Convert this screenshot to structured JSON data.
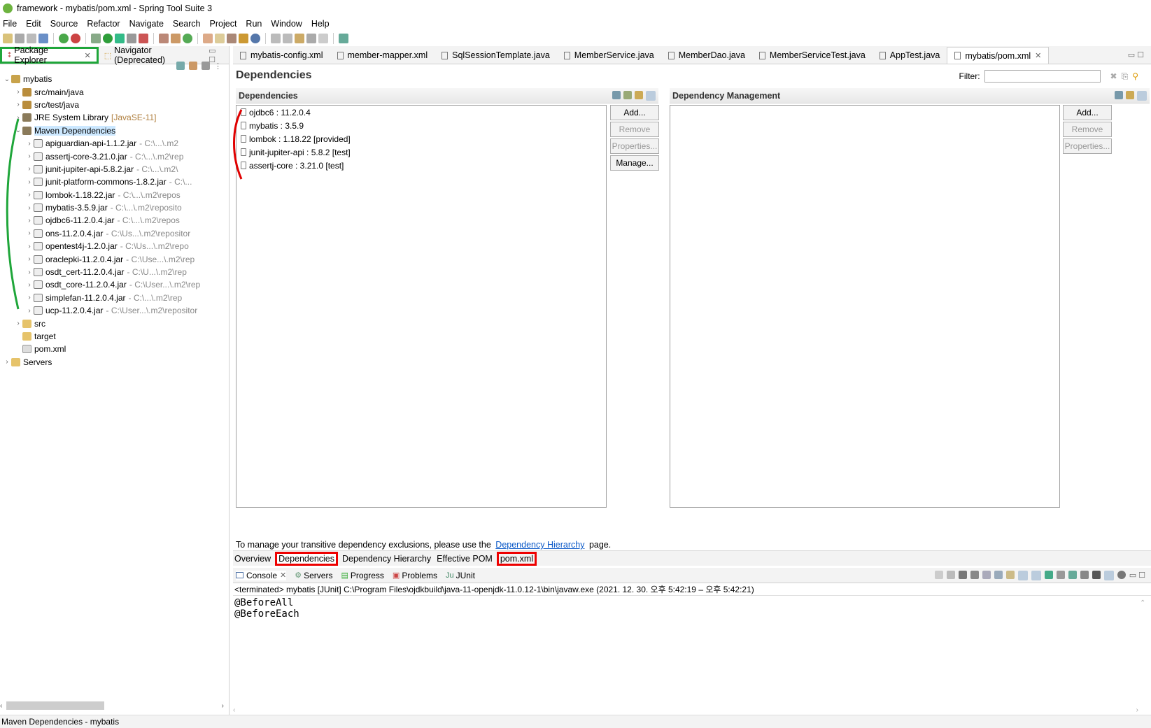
{
  "window": {
    "title": "framework - mybatis/pom.xml - Spring Tool Suite 3"
  },
  "menu": [
    "File",
    "Edit",
    "Source",
    "Refactor",
    "Navigate",
    "Search",
    "Project",
    "Run",
    "Window",
    "Help"
  ],
  "left_panel": {
    "tabs": [
      {
        "label": "Package Explorer",
        "active": true
      },
      {
        "label": "Navigator (Deprecated)",
        "active": false
      }
    ],
    "tree": [
      {
        "label": "mybatis",
        "indent": 0,
        "icon": "project-icon",
        "expanded": true
      },
      {
        "label": "src/main/java",
        "indent": 1,
        "icon": "package-folder-icon"
      },
      {
        "label": "src/test/java",
        "indent": 1,
        "icon": "package-folder-icon"
      },
      {
        "label": "JRE System Library",
        "suffix": "[JavaSE-11]",
        "indent": 1,
        "icon": "library-icon"
      },
      {
        "label": "Maven Dependencies",
        "indent": 1,
        "icon": "library-icon",
        "expanded": true,
        "selected": true
      },
      {
        "label": "apiguardian-api-1.1.2.jar",
        "path": "- C:\\...\\.m2",
        "indent": 2,
        "icon": "jar-icon"
      },
      {
        "label": "assertj-core-3.21.0.jar",
        "path": "- C:\\...\\.m2\\rep",
        "indent": 2,
        "icon": "jar-icon"
      },
      {
        "label": "junit-jupiter-api-5.8.2.jar",
        "path": "- C:\\...\\.m2\\",
        "indent": 2,
        "icon": "jar-icon"
      },
      {
        "label": "junit-platform-commons-1.8.2.jar",
        "path": "- C:\\...",
        "indent": 2,
        "icon": "jar-icon"
      },
      {
        "label": "lombok-1.18.22.jar",
        "path": "- C:\\...\\.m2\\repos",
        "indent": 2,
        "icon": "jar-icon"
      },
      {
        "label": "mybatis-3.5.9.jar",
        "path": "- C:\\...\\.m2\\reposito",
        "indent": 2,
        "icon": "jar-icon"
      },
      {
        "label": "ojdbc6-11.2.0.4.jar",
        "path": "- C:\\...\\.m2\\repos",
        "indent": 2,
        "icon": "jar-icon"
      },
      {
        "label": "ons-11.2.0.4.jar",
        "path": "- C:\\Us...\\.m2\\repositor",
        "indent": 2,
        "icon": "jar-icon"
      },
      {
        "label": "opentest4j-1.2.0.jar",
        "path": "- C:\\Us...\\.m2\\repo",
        "indent": 2,
        "icon": "jar-icon"
      },
      {
        "label": "oraclepki-11.2.0.4.jar",
        "path": "- C:\\Use...\\.m2\\rep",
        "indent": 2,
        "icon": "jar-icon"
      },
      {
        "label": "osdt_cert-11.2.0.4.jar",
        "path": "- C:\\U...\\.m2\\rep",
        "indent": 2,
        "icon": "jar-icon"
      },
      {
        "label": "osdt_core-11.2.0.4.jar",
        "path": "- C:\\User...\\.m2\\rep",
        "indent": 2,
        "icon": "jar-icon"
      },
      {
        "label": "simplefan-11.2.0.4.jar",
        "path": "- C:\\...\\.m2\\rep",
        "indent": 2,
        "icon": "jar-icon"
      },
      {
        "label": "ucp-11.2.0.4.jar",
        "path": "- C:\\User...\\.m2\\repositor",
        "indent": 2,
        "icon": "jar-icon"
      },
      {
        "label": "src",
        "indent": 1,
        "icon": "folder-icon"
      },
      {
        "label": "target",
        "indent": 1,
        "icon": "folder-icon",
        "noarrow": true
      },
      {
        "label": "pom.xml",
        "indent": 1,
        "icon": "file-icon",
        "noarrow": true
      },
      {
        "label": "Servers",
        "indent": 0,
        "icon": "folder-icon"
      }
    ]
  },
  "editor": {
    "tabs": [
      {
        "label": "mybatis-config.xml"
      },
      {
        "label": "member-mapper.xml"
      },
      {
        "label": "SqlSessionTemplate.java"
      },
      {
        "label": "MemberService.java"
      },
      {
        "label": "MemberDao.java"
      },
      {
        "label": "MemberServiceTest.java"
      },
      {
        "label": "AppTest.java"
      },
      {
        "label": "mybatis/pom.xml",
        "active": true
      }
    ],
    "page_title": "Dependencies",
    "filter_label": "Filter:",
    "dependencies": {
      "header": "Dependencies",
      "items": [
        "ojdbc6 : 11.2.0.4",
        "mybatis : 3.5.9",
        "lombok : 1.18.22 [provided]",
        "junit-jupiter-api : 5.8.2 [test]",
        "assertj-core : 3.21.0 [test]"
      ],
      "buttons": {
        "add": "Add...",
        "remove": "Remove",
        "properties": "Properties...",
        "manage": "Manage..."
      }
    },
    "dependency_management": {
      "header": "Dependency Management",
      "buttons": {
        "add": "Add...",
        "remove": "Remove",
        "properties": "Properties..."
      }
    },
    "hint_prefix": "To manage your transitive dependency exclusions, please use the",
    "hint_link": "Dependency Hierarchy",
    "hint_suffix": "page.",
    "page_tabs": [
      "Overview",
      "Dependencies",
      "Dependency Hierarchy",
      "Effective POM",
      "pom.xml"
    ]
  },
  "console": {
    "tabs": [
      "Console",
      "Servers",
      "Progress",
      "Problems",
      "JUnit"
    ],
    "status_line": "<terminated> mybatis [JUnit] C:\\Program Files\\ojdkbuild\\java-11-openjdk-11.0.12-1\\bin\\javaw.exe  (2021. 12. 30. 오후 5:42:19 – 오후 5:42:21)",
    "output": [
      "@BeforeAll",
      "@BeforeEach"
    ]
  },
  "statusbar": {
    "text": "Maven Dependencies - mybatis"
  },
  "colors": {
    "annotation_green": "#1fa63a",
    "annotation_red": "#e00000",
    "selection": "#cce8ff",
    "link": "#0b59c8"
  }
}
